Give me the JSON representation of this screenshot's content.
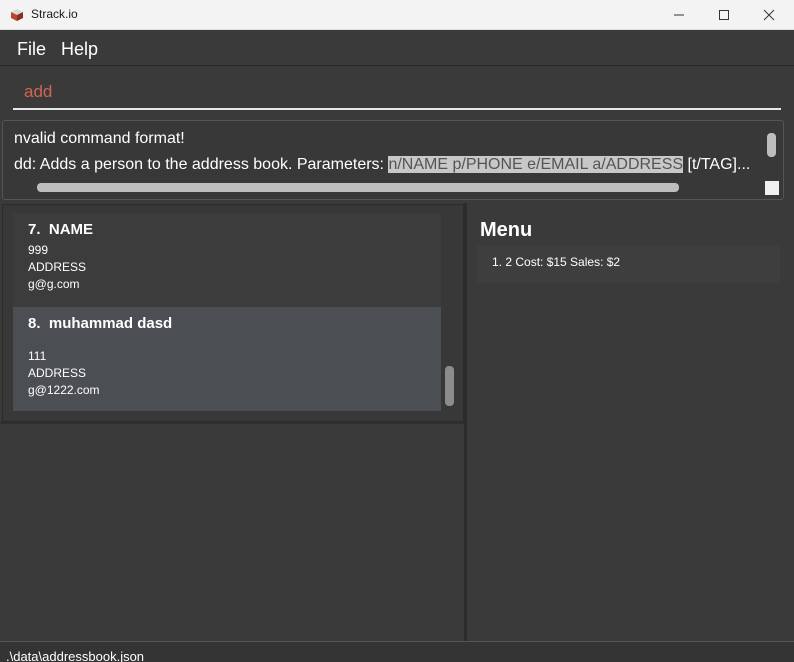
{
  "window": {
    "title": "Strack.io"
  },
  "menubar": {
    "items": [
      {
        "label": "File"
      },
      {
        "label": "Help"
      }
    ]
  },
  "command": {
    "value": "add"
  },
  "result": {
    "line1": "nvalid command format!",
    "line2_prefix": "dd: Adds a person to the address book. Parameters: ",
    "line2_highlight": "n/NAME p/PHONE e/EMAIL a/ADDRESS",
    "line2_suffix": " [t/TAG]..."
  },
  "persons": [
    {
      "index": "7.",
      "name": "NAME",
      "phone": "999",
      "address": "ADDRESS",
      "email": "g@g.com"
    },
    {
      "index": "8.",
      "name": "muhammad dasd",
      "phone": "111",
      "address": "ADDRESS",
      "email": "g@1222.com"
    }
  ],
  "menu_panel": {
    "title": "Menu",
    "items": [
      {
        "text": "1. 2  Cost: $15  Sales: $2"
      }
    ]
  },
  "status": {
    "path": ".\\data\\addressbook.json"
  },
  "colors": {
    "background": "#3a3a3a",
    "command_text": "#d06651",
    "selected_card": "#4b4f53"
  }
}
